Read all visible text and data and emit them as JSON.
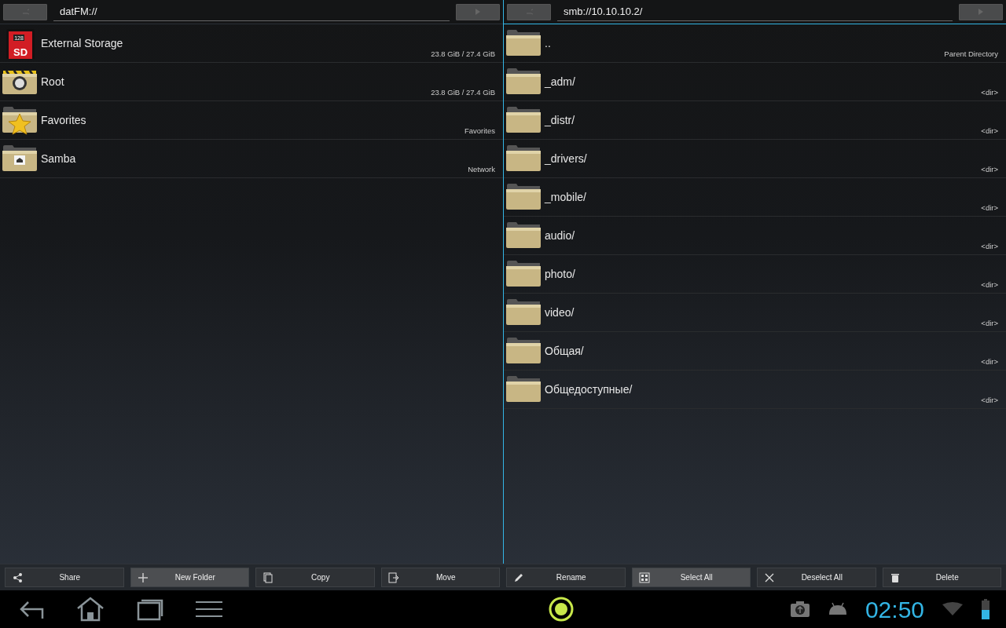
{
  "panes": [
    {
      "path": "datFM://",
      "active": false,
      "items": [
        {
          "kind": "sd",
          "name": "External Storage",
          "info": "23.8 GiB / 27.4 GiB",
          "icon_texts": [
            "128",
            "SD"
          ]
        },
        {
          "kind": "root",
          "name": "Root",
          "info": "23.8 GiB / 27.4 GiB"
        },
        {
          "kind": "star",
          "name": "Favorites",
          "info": "Favorites"
        },
        {
          "kind": "samba",
          "name": "Samba",
          "info": "Network"
        }
      ]
    },
    {
      "path": "smb://10.10.10.2/",
      "active": true,
      "items": [
        {
          "kind": "folder",
          "name": "..",
          "info": "Parent Directory"
        },
        {
          "kind": "folder",
          "name": "_adm/",
          "info": "<dir>"
        },
        {
          "kind": "folder",
          "name": "_distr/",
          "info": "<dir>"
        },
        {
          "kind": "folder",
          "name": "_drivers/",
          "info": "<dir>"
        },
        {
          "kind": "folder",
          "name": "_mobile/",
          "info": "<dir>"
        },
        {
          "kind": "folder",
          "name": "audio/",
          "info": "<dir>"
        },
        {
          "kind": "folder",
          "name": "photo/",
          "info": "<dir>"
        },
        {
          "kind": "folder",
          "name": "video/",
          "info": "<dir>"
        },
        {
          "kind": "folder",
          "name": "Общая/",
          "info": "<dir>"
        },
        {
          "kind": "folder",
          "name": "Общедоступные/",
          "info": "<dir>"
        }
      ]
    }
  ],
  "toolbar": [
    {
      "kind": "share",
      "label": "Share",
      "highlighted": false
    },
    {
      "kind": "plus",
      "label": "New Folder",
      "highlighted": true
    },
    {
      "kind": "copy",
      "label": "Copy",
      "highlighted": false
    },
    {
      "kind": "move",
      "label": "Move",
      "highlighted": false
    },
    {
      "kind": "pencil",
      "label": "Rename",
      "highlighted": false
    },
    {
      "kind": "grid",
      "label": "Select All",
      "highlighted": true
    },
    {
      "kind": "x",
      "label": "Deselect All",
      "highlighted": false
    },
    {
      "kind": "trash",
      "label": "Delete",
      "highlighted": false
    }
  ],
  "status_bar": {
    "time": "02:50"
  }
}
